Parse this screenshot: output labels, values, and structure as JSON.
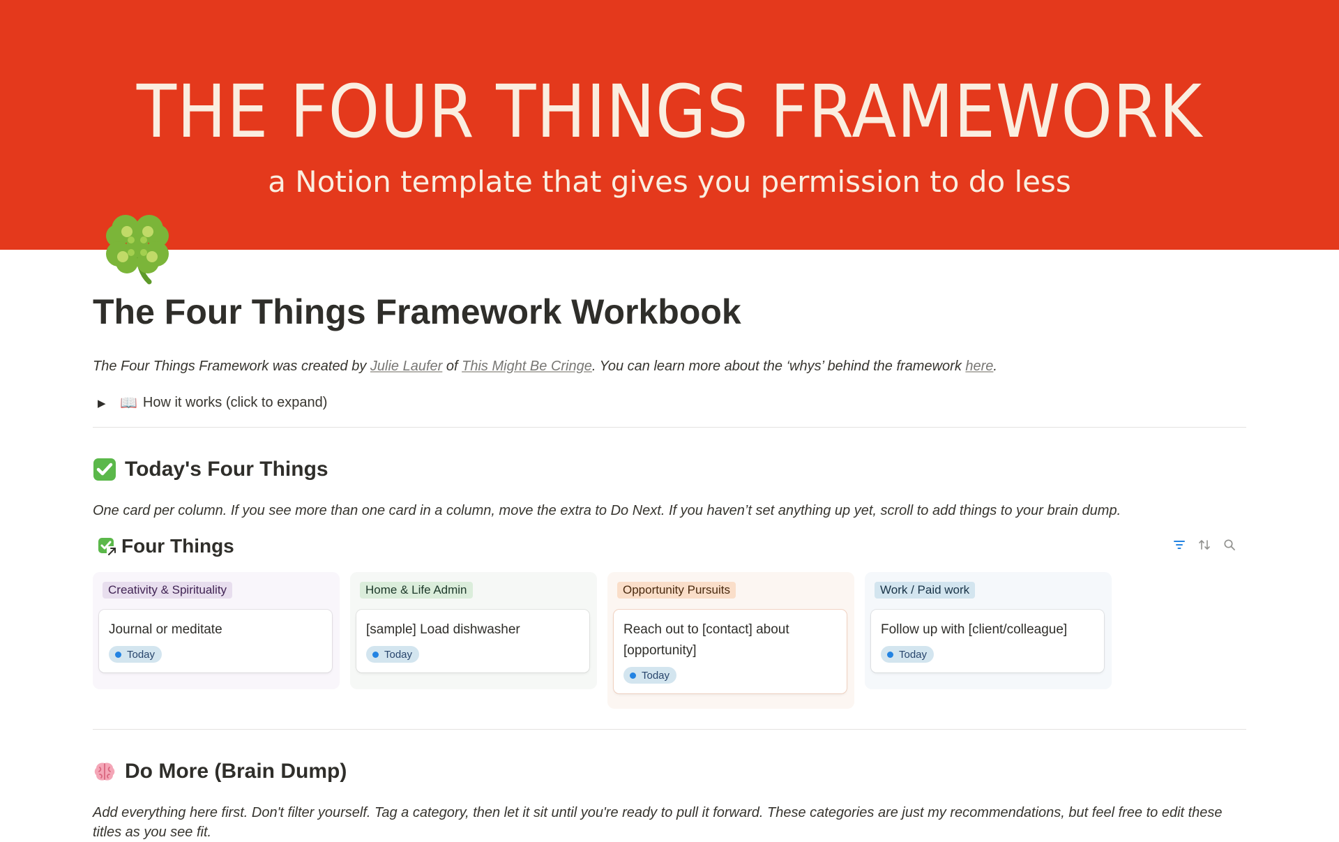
{
  "cover": {
    "title": "THE FOUR THINGS FRAMEWORK",
    "subtitle": "a Notion template that gives you permission to do less",
    "background": "#e4391c"
  },
  "page": {
    "icon": "four-leaf-clover-icon",
    "title": "The Four Things Framework Workbook"
  },
  "intro": {
    "part1": "The Four Things Framework was created by ",
    "link1": "Julie Laufer",
    "part2": " of ",
    "link2": "This Might Be Cringe",
    "part3": ". You can learn more about the ‘whys’ behind the framework ",
    "link3": "here",
    "part4": "."
  },
  "toggle": {
    "emoji": "📖",
    "label": "How it works (click to expand)"
  },
  "section_today": {
    "emoji": "check-mark-button-icon",
    "heading": "Today's Four Things",
    "description": "One card per column. If you see more than one card in a column, move the extra to Do Next. If you haven’t set anything up yet, scroll to add things to your brain dump."
  },
  "database": {
    "title": "Four Things",
    "tools": [
      "filter-icon",
      "sort-icon",
      "search-icon"
    ],
    "columns": [
      {
        "tag": "Creativity & Spirituality",
        "tag_bg": "#e8deee",
        "tag_color": "#412454",
        "col_bg": "#f9f6fb",
        "card": {
          "title": "Journal or meditate",
          "badge": "Today"
        }
      },
      {
        "tag": "Home & Life Admin",
        "tag_bg": "#dbeddb",
        "tag_color": "#1c3829",
        "col_bg": "#f6f8f6",
        "card": {
          "title": "[sample] Load dishwasher",
          "badge": "Today"
        }
      },
      {
        "tag": "Opportunity Pursuits",
        "tag_bg": "#fadec9",
        "tag_color": "#49290e",
        "col_bg": "#fcf6f2",
        "card": {
          "title": "Reach out to [contact] about [opportunity]",
          "badge": "Today"
        }
      },
      {
        "tag": "Work / Paid work",
        "tag_bg": "#d3e5ef",
        "tag_color": "#183347",
        "col_bg": "#f5f8fb",
        "card": {
          "title": "Follow up with [client/colleague]",
          "badge": "Today"
        }
      }
    ]
  },
  "section_brain": {
    "emoji": "brain-icon",
    "heading": "Do More (Brain Dump)",
    "description": "Add everything here first. Don't filter yourself. Tag a category, then let it sit until you're ready to pull it forward. These categories are just my recommendations, but feel free to edit these titles as you see fit."
  }
}
